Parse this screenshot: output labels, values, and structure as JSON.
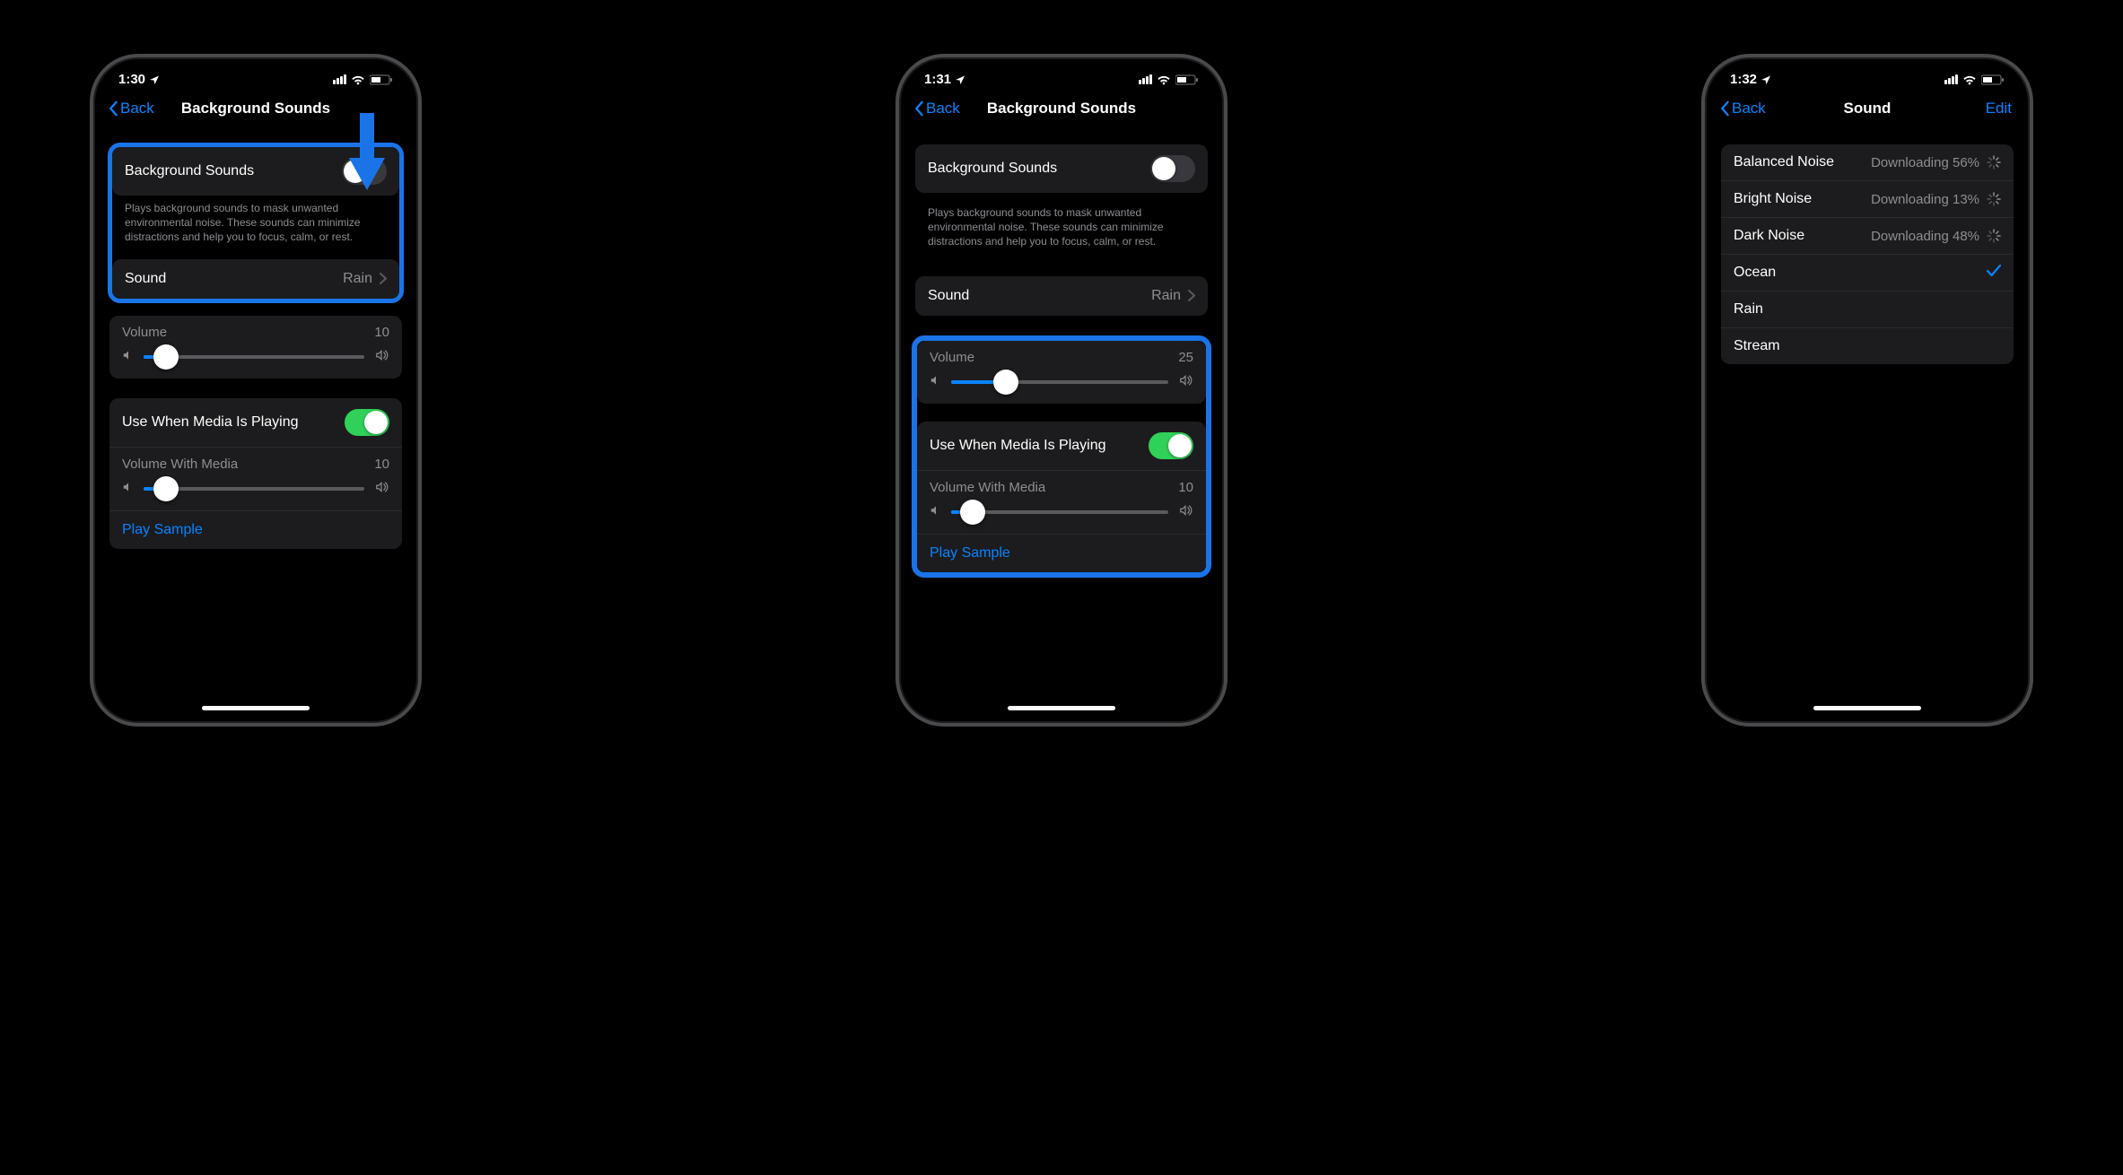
{
  "phone1": {
    "time": "1:30",
    "back": "Back",
    "title": "Background Sounds",
    "bgsounds_label": "Background Sounds",
    "bgsounds_desc": "Plays background sounds to mask unwanted environmental noise. These sounds can minimize distractions and help you to focus, calm, or rest.",
    "sound_label": "Sound",
    "sound_value": "Rain",
    "volume_label": "Volume",
    "volume_value": "10",
    "volume_pct": 10,
    "media_label": "Use When Media Is Playing",
    "volmedia_label": "Volume With Media",
    "volmedia_value": "10",
    "volmedia_pct": 10,
    "play_sample": "Play Sample"
  },
  "phone2": {
    "time": "1:31",
    "back": "Back",
    "title": "Background Sounds",
    "bgsounds_label": "Background Sounds",
    "bgsounds_desc": "Plays background sounds to mask unwanted environmental noise. These sounds can minimize distractions and help you to focus, calm, or rest.",
    "sound_label": "Sound",
    "sound_value": "Rain",
    "volume_label": "Volume",
    "volume_value": "25",
    "volume_pct": 25,
    "media_label": "Use When Media Is Playing",
    "volmedia_label": "Volume With Media",
    "volmedia_value": "10",
    "volmedia_pct": 10,
    "play_sample": "Play Sample"
  },
  "phone3": {
    "time": "1:32",
    "back": "Back",
    "title": "Sound",
    "edit": "Edit",
    "items": [
      {
        "name": "Balanced Noise",
        "status": "Downloading 56%",
        "state": "downloading"
      },
      {
        "name": "Bright Noise",
        "status": "Downloading 13%",
        "state": "downloading"
      },
      {
        "name": "Dark Noise",
        "status": "Downloading 48%",
        "state": "downloading"
      },
      {
        "name": "Ocean",
        "status": "",
        "state": "selected"
      },
      {
        "name": "Rain",
        "status": "",
        "state": "none"
      },
      {
        "name": "Stream",
        "status": "",
        "state": "none"
      }
    ]
  }
}
